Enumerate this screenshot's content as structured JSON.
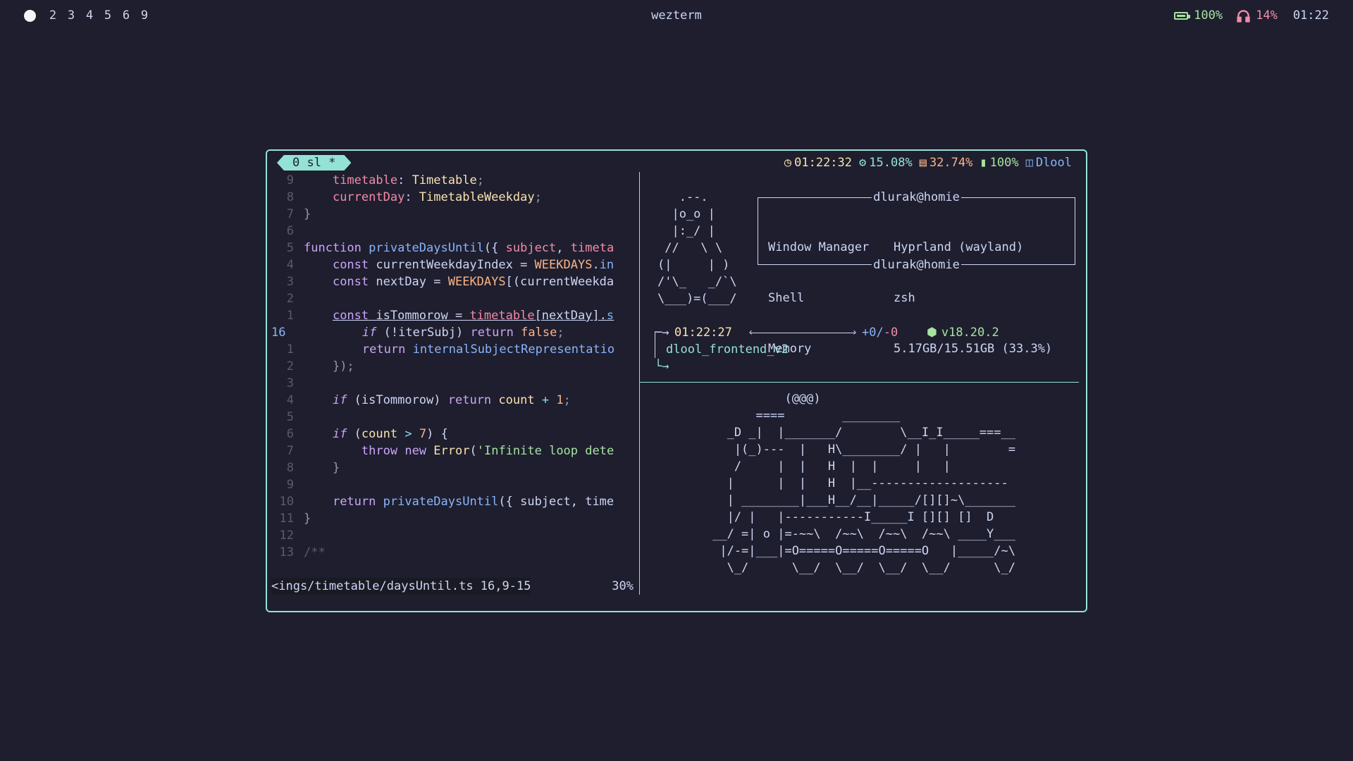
{
  "topbar": {
    "workspaces": [
      "2",
      "3",
      "4",
      "5",
      "6",
      "9"
    ],
    "title": "wezterm",
    "battery": "100%",
    "headphones": "14%",
    "clock": "01:22"
  },
  "tab": {
    "label": "0 sl *"
  },
  "tabstatus": {
    "time": "01:22:32",
    "cpu": "15.08%",
    "mem": "32.74%",
    "battery": "100%",
    "user": "Dlool"
  },
  "editor": {
    "statusline_file": "<ings/timetable/daysUntil.ts 16,9-15",
    "statusline_percent": "30%"
  },
  "fetch": {
    "ascii": "   .--.\n  |o_o |\n  |:_/ |\n //   \\ \\\n(|     | )\n/'\\_   _/`\\\n\\___)=(___/",
    "header": "dlurak@homie",
    "footer": "dlurak@homie",
    "rows": [
      {
        "key": "Window Manager",
        "value": "Hyprland (wayland)"
      },
      {
        "key": "Shell",
        "value": "zsh"
      },
      {
        "key": "Memory",
        "value": "5.17GB/15.51GB (33.3%)"
      }
    ]
  },
  "prompt": {
    "time": "01:22:27",
    "git_add": "+0",
    "git_sep": "/",
    "git_del": "-0",
    "node": "v18.20.2",
    "dir": "dlool_frontend_v2",
    "arrow_top": "─→",
    "arrow_bottom": "└→"
  },
  "train": "                   (@@@)\n               ====        ________\n           _D _|  |_______/        \\__I_I_____===__\n            |(_)---  |   H\\________/ |   |        =\n            /     |  |   H  |  |     |   |\n           |      |  |   H  |__-------------------\n           | ________|___H__/__|_____/[][]~\\_______\n           |/ |   |-----------I_____I [][] []  D\n         __/ =| o |=-~~\\  /~~\\  /~~\\  /~~\\ ____Y___\n          |/-=|___|=O=====O=====O=====O   |_____/~\\\n           \\_/      \\__/  \\__/  \\__/  \\__/      \\_/"
}
